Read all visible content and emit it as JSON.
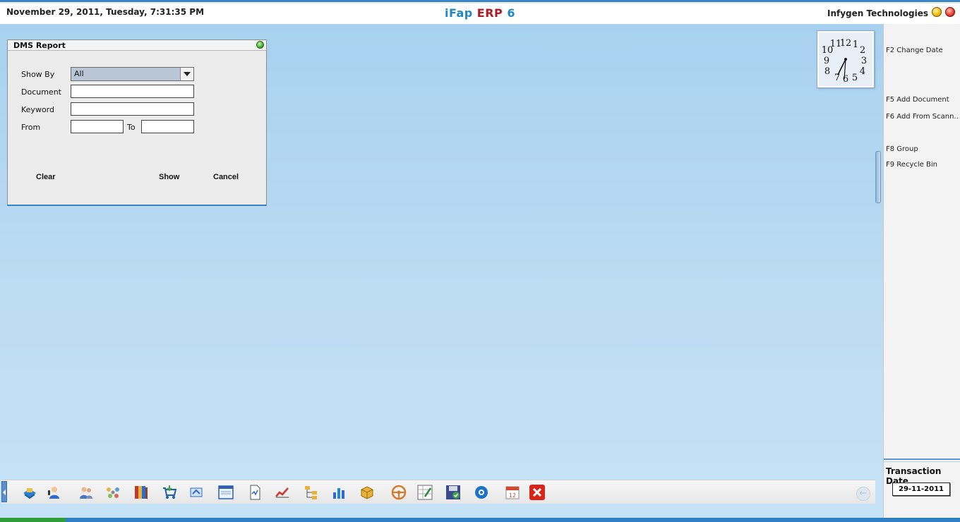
{
  "header": {
    "datetime": "November  29, 2011, Tuesday, 7:31:35 PM",
    "title_part1": "iFap",
    "title_part2": "ERP",
    "title_part3": "6",
    "company": "Infygen Technologies"
  },
  "clock": {
    "numbers": [
      "12",
      "1",
      "2",
      "3",
      "4",
      "5",
      "6",
      "7",
      "8",
      "9",
      "10",
      "11"
    ]
  },
  "dialog": {
    "title": "DMS Report",
    "show_by_label": "Show By",
    "show_by_value": "All",
    "document_label": "Document",
    "document_value": "",
    "keyword_label": "Keyword",
    "keyword_value": "",
    "from_label": "From",
    "from_value": "",
    "to_label": "To",
    "to_value": "",
    "clear_label": "Clear",
    "show_label": "Show",
    "cancel_label": "Cancel"
  },
  "right_panel": {
    "f2": "F2 Change Date",
    "f5": "F5 Add Document",
    "f6": "F6 Add From Scann...",
    "f8": "F8 Group",
    "f9": "F9 Recycle Bin",
    "transaction_label": "Transaction Date",
    "transaction_value": "29-11-2011"
  },
  "taskbar": {
    "icons": [
      "money-icon",
      "phone-user-icon",
      "people-icon",
      "network-icon",
      "books-icon",
      "cart-icon",
      "sync-icon",
      "window-icon",
      "document-icon",
      "graph-icon",
      "tree-icon",
      "chart-icon",
      "package-icon",
      "steering-icon",
      "spreadsheet-icon",
      "save-check-icon",
      "gear-icon",
      "calendar-icon",
      "exit-icon"
    ],
    "calendar_day": "12"
  },
  "colors": {
    "accent": "#1f86c7",
    "erp_red": "#b11a24",
    "desktop": "#b8d9f2"
  }
}
